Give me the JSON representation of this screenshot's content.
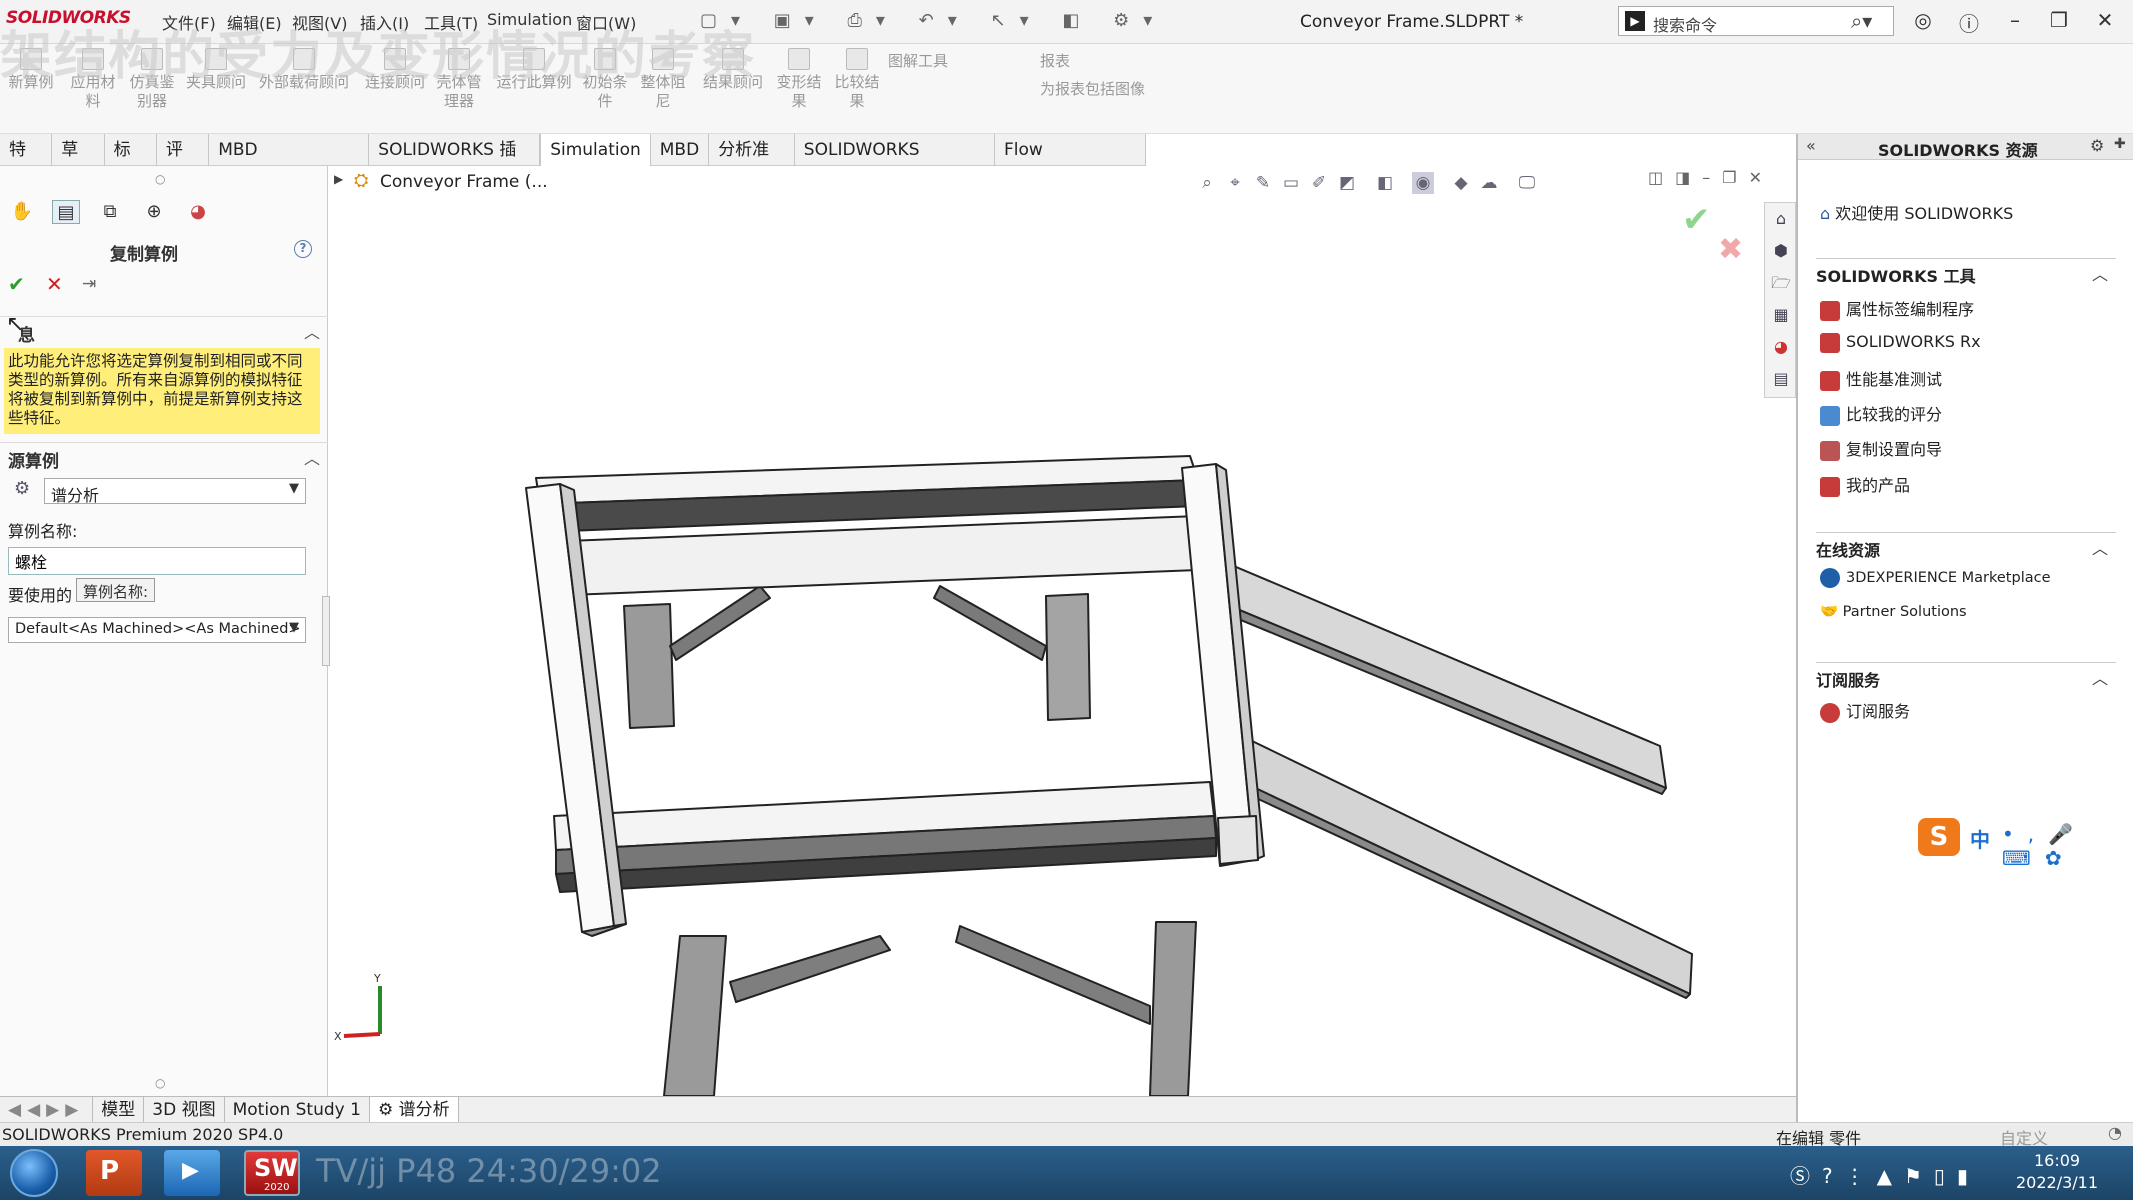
{
  "app": {
    "logo_text": "SOLIDWORKS",
    "document_title": "Conveyor Frame.SLDPRT *",
    "menu": [
      "文件(F)",
      "编辑(E)",
      "视图(V)",
      "插入(I)",
      "工具(T)",
      "Simulation",
      "窗口(W)"
    ],
    "search_placeholder": "搜索命令",
    "watermark": "架结构的受力及变形情况的考察"
  },
  "ribbon": {
    "buttons": [
      "新算例",
      "应用材料",
      "仿真鉴别器",
      "夹具顾问",
      "外部载荷顾问",
      "连接顾问",
      "壳体管理器",
      "运行此算例",
      "初始条件",
      "整体阻尼",
      "结果顾问",
      "变形结果",
      "比较结果"
    ],
    "right_items": [
      "图解工具",
      "报表",
      "为报表包括图像"
    ]
  },
  "tabs": [
    "特征",
    "草图",
    "标注",
    "评估",
    "MBD Dimensions",
    "SOLIDWORKS 插件",
    "Simulation",
    "MBD",
    "分析准备",
    "SOLIDWORKS Plastics",
    "Flow Simulation"
  ],
  "active_tab": "Simulation",
  "property_manager": {
    "title": "复制算例",
    "info_section": "息",
    "info_text": "此功能允许您将选定算例复制到相同或不同类型的新算例。所有来自源算例的模拟特征将被复制到新算例中，前提是新算例支持这些特征。",
    "source_section": "源算例",
    "source_value": "谱分析",
    "study_name_label": "算例名称:",
    "study_name_value": "螺栓",
    "config_label": "要使用的",
    "tooltip": "算例名称:",
    "config_value": "Default<As Machined><As Machined>"
  },
  "viewport": {
    "tree_root": "Conveyor Frame  (..."
  },
  "bottom_tabs": [
    "模型",
    "3D 视图",
    "Motion Study 1",
    "谱分析"
  ],
  "status": {
    "left": "SOLIDWORKS Premium 2020 SP4.0",
    "mid": "在编辑 零件",
    "right": "自定义"
  },
  "task_pane": {
    "title": "SOLIDWORKS 资源",
    "welcome": "欢迎使用  SOLIDWORKS",
    "tools_section": "SOLIDWORKS 工具",
    "tools": [
      "属性标签编制程序",
      "SOLIDWORKS Rx",
      "性能基准测试",
      "比较我的评分",
      "复制设置向导",
      "我的产品"
    ],
    "online_section": "在线资源",
    "online": [
      "3DEXPERIENCE Marketplace",
      "Partner Solutions"
    ],
    "sub_section": "订阅服务",
    "sub": [
      "订阅服务"
    ]
  },
  "taskbar": {
    "time": "16:09",
    "date": "2022/3/11",
    "video_overlay": "TV/jj P48 24:30/29:02",
    "sw_badge": "2020"
  },
  "ime": {
    "lang": "中"
  }
}
